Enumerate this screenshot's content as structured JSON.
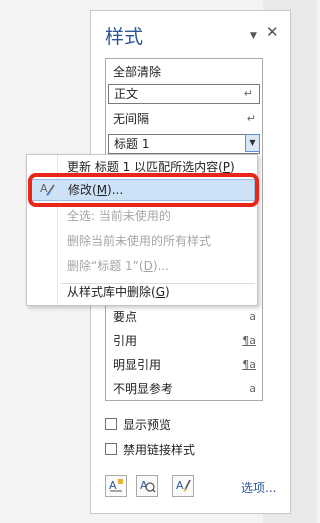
{
  "pane": {
    "title": "样式",
    "menu_arrow": "▼",
    "close": "✕"
  },
  "styles": {
    "items": [
      {
        "label": "全部清除",
        "mark": ""
      },
      {
        "label": "正文",
        "mark": "↵"
      },
      {
        "label": "无间隔",
        "mark": "↵"
      },
      {
        "label": "标题 1",
        "mark": "▼"
      },
      {
        "label": "要点",
        "mark": "a"
      },
      {
        "label": "引用",
        "mark": "¶a"
      },
      {
        "label": "明显引用",
        "mark": "¶a"
      },
      {
        "label": "不明显参考",
        "mark": "a"
      }
    ]
  },
  "context_menu": {
    "items": [
      {
        "label": "更新 标题 1 以匹配所选内容(",
        "accel": "P",
        "suffix": ")",
        "disabled": false
      },
      {
        "label": "修改(",
        "accel": "M",
        "suffix": ")...",
        "disabled": false,
        "highlighted": true
      },
      {
        "label": "全选: 当前未使用的",
        "accel": "",
        "suffix": "",
        "disabled": true
      },
      {
        "label": "删除当前未使用的所有样式",
        "accel": "",
        "suffix": "",
        "disabled": true
      },
      {
        "label": "删除“标题 1”(",
        "accel": "D",
        "suffix": ")...",
        "disabled": true
      },
      {
        "label": "从样式库中删除(",
        "accel": "G",
        "suffix": ")",
        "disabled": false
      }
    ]
  },
  "options": {
    "show_preview": "显示预览",
    "disable_linked": "禁用链接样式"
  },
  "footer": {
    "options_link": "选项..."
  },
  "colors": {
    "accent": "#2b579a",
    "highlight": "#cde2f7",
    "callout": "#e8261a"
  }
}
